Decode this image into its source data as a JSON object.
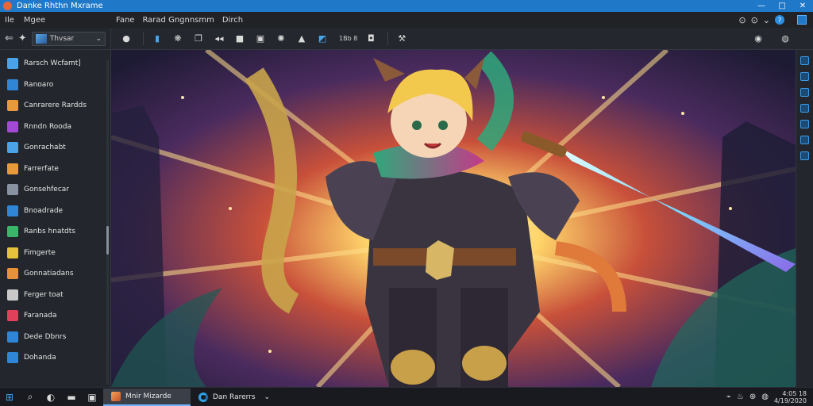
{
  "window": {
    "title": "Danke Rhthn Mxrame",
    "controls": {
      "minimize": "—",
      "maximize": "□",
      "close": "✕"
    }
  },
  "menubar": {
    "left": [
      "Ile",
      "Mgee"
    ],
    "right": [
      "Fane",
      "Rarad Gngnnsmm",
      "Dirch"
    ],
    "status_icons": [
      "⊙",
      "⊙",
      "⌄"
    ],
    "help_badge": "?"
  },
  "sidebar": {
    "back_label": "⇐",
    "nav_label": "✦",
    "search_value": "Thvsar",
    "items": [
      {
        "label": "Rarsch Wcfamt]",
        "color": "#4aa3e8"
      },
      {
        "label": "Ranoaro",
        "color": "#2f86d6"
      },
      {
        "label": "Canrarere Rardds",
        "color": "#e69a3a"
      },
      {
        "label": "Rnndn Rooda",
        "color": "#a24ad6"
      },
      {
        "label": "Gonrachabt",
        "color": "#4aa3e8"
      },
      {
        "label": "Farrerfate",
        "color": "#e69a3a"
      },
      {
        "label": "Gonsehfecar",
        "color": "#8892a0"
      },
      {
        "label": "Bnoadrade",
        "color": "#2f86d6"
      },
      {
        "label": "Ranbs hnatdts",
        "color": "#3bb56a"
      },
      {
        "label": "Fimgerte",
        "color": "#e6c23a"
      },
      {
        "label": "Gonnatiadans",
        "color": "#e6923a"
      },
      {
        "label": "Ferger toat",
        "color": "#c9c9c9"
      },
      {
        "label": "Faranada",
        "color": "#e0405a"
      },
      {
        "label": "Dede Dbnrs",
        "color": "#2f86d6"
      },
      {
        "label": "Dohanda",
        "color": "#2f86d6"
      }
    ]
  },
  "toolbar": {
    "tools": [
      "●",
      "▮",
      "❋",
      "❐",
      "◂◂",
      "■",
      "▣",
      "✺",
      "▲",
      "◩"
    ],
    "zoom_text": "1Bb 8",
    "extra": [
      "◘",
      "⚒"
    ],
    "right_tools": [
      "◉",
      "◍"
    ]
  },
  "taskbar": {
    "start_icon": "⊞",
    "search_icon": "⌕",
    "pinned": [
      "◐",
      "▬",
      "▣"
    ],
    "apps": [
      {
        "label": "Mnir Mizarde",
        "active": true
      },
      {
        "label": "Dan Rarerrs",
        "active": false
      }
    ],
    "tray_icons": [
      "⌁",
      "♨",
      "⊕",
      "◍"
    ],
    "clock_time": "4:05 18",
    "clock_date": "4/19/2020"
  },
  "colors": {
    "accent": "#1f78c8",
    "sidebar_bg": "#23262c",
    "taskbar_bg": "#181a1f"
  }
}
